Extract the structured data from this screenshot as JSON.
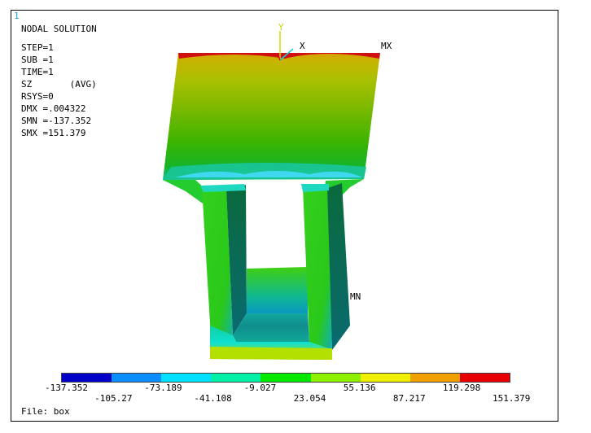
{
  "window_number": "1",
  "info": {
    "title": "NODAL SOLUTION",
    "lines": [
      "STEP=1",
      "SUB =1",
      "TIME=1",
      "SZ       (AVG)",
      "RSYS=0",
      "DMX =.004322",
      "SMN =-137.352",
      "SMX =151.379"
    ]
  },
  "triad": {
    "y_label": "Y",
    "x_label": "X"
  },
  "markers": {
    "max_label": "MX",
    "min_label": "MN"
  },
  "legend": {
    "colors": [
      "#0000c8",
      "#0b8cff",
      "#00e0ff",
      "#00f0a8",
      "#00e800",
      "#8cf000",
      "#f0f000",
      "#f0a000",
      "#e80000"
    ],
    "labels_top": [
      "-137.352",
      "-73.189",
      "-9.027",
      "55.136",
      "119.298"
    ],
    "labels_bottom": [
      "-105.27",
      "-41.108",
      "23.054",
      "87.217",
      "151.379"
    ]
  },
  "file_label": "File: box"
}
